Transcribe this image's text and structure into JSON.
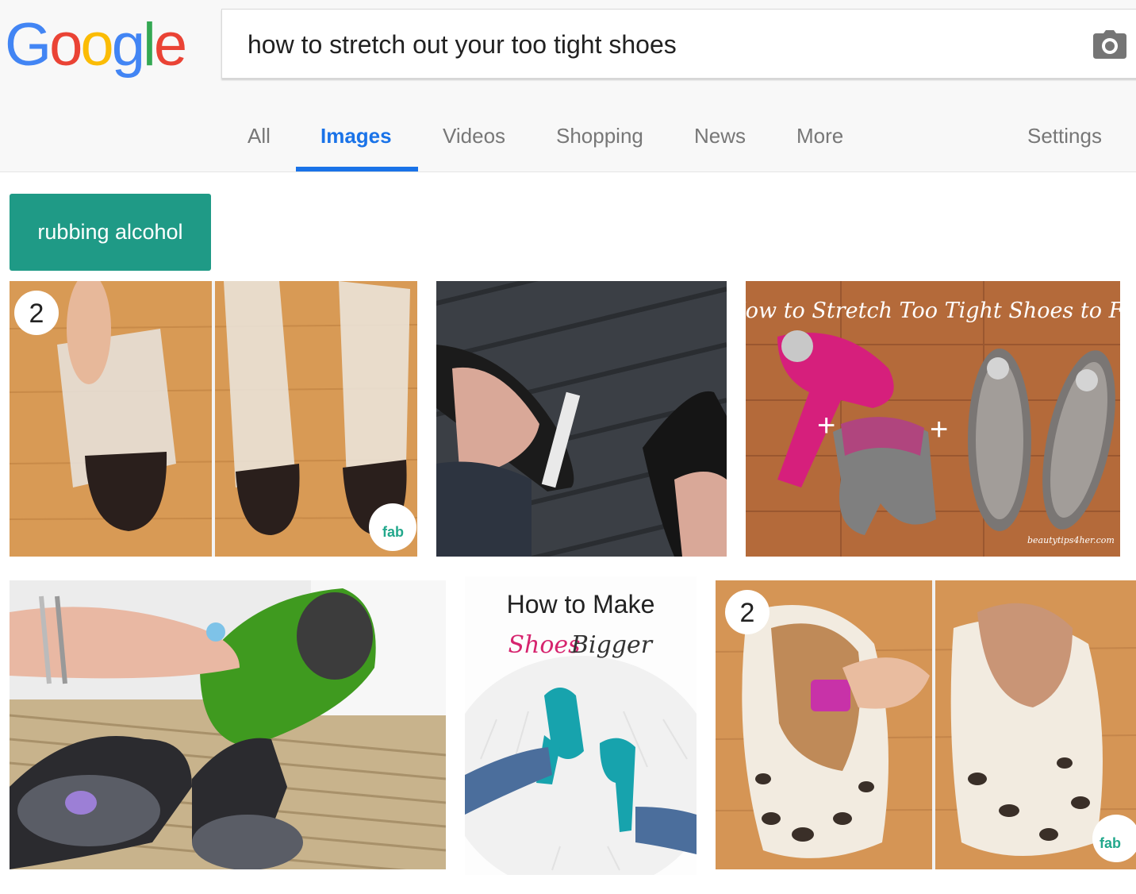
{
  "logo": {
    "letters": [
      "G",
      "o",
      "o",
      "g",
      "l",
      "e"
    ],
    "colors": [
      "#4285F4",
      "#EA4335",
      "#FBBC05",
      "#4285F4",
      "#34A853",
      "#EA4335"
    ]
  },
  "search": {
    "query": "how to stretch out your too tight shoes",
    "camera_icon": "camera-icon"
  },
  "tabs": [
    {
      "label": "All",
      "active": false
    },
    {
      "label": "Images",
      "active": true
    },
    {
      "label": "Videos",
      "active": false
    },
    {
      "label": "Shopping",
      "active": false
    },
    {
      "label": "News",
      "active": false
    },
    {
      "label": "More",
      "active": false
    }
  ],
  "settings_label": "Settings",
  "chip": {
    "label": "rubbing alcohol",
    "color": "#1f9a86"
  },
  "results": [
    {
      "badge": "2",
      "watermark": "fab"
    },
    {},
    {
      "title": "How to Stretch Too Tight Shoes to Fit",
      "credit": "beautytips4her.com"
    },
    {},
    {
      "title_line1": "How to Make",
      "title_line2a": "Shoes",
      "title_line2b": "Bigger"
    },
    {
      "badge": "2",
      "watermark": "fab"
    }
  ],
  "accent": "#1a73e8"
}
